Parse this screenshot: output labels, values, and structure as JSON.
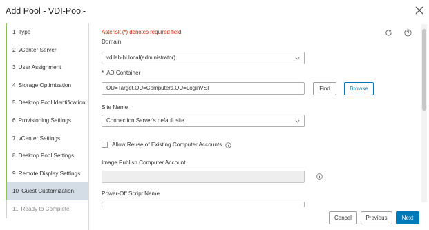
{
  "dialog": {
    "title": "Add Pool - VDI-Pool-"
  },
  "sidebar": {
    "steps": [
      {
        "num": "1",
        "label": "Type"
      },
      {
        "num": "2",
        "label": "vCenter Server"
      },
      {
        "num": "3",
        "label": "User Assignment"
      },
      {
        "num": "4",
        "label": "Storage Optimization"
      },
      {
        "num": "5",
        "label": "Desktop Pool Identification"
      },
      {
        "num": "6",
        "label": "Provisioning Settings"
      },
      {
        "num": "7",
        "label": "vCenter Settings"
      },
      {
        "num": "8",
        "label": "Desktop Pool Settings"
      },
      {
        "num": "9",
        "label": "Remote Display Settings"
      },
      {
        "num": "10",
        "label": "Guest Customization"
      },
      {
        "num": "11",
        "label": "Ready to Complete"
      }
    ],
    "active_step": "10"
  },
  "form": {
    "required_note": "Asterisk (*) denotes required field",
    "domain": {
      "label": "Domain",
      "value": "vdilab-hi.local(administrator)"
    },
    "ad_container": {
      "star": "*",
      "label": "AD Container",
      "value": "OU=Target,OU=Computers,OU=LoginVSI",
      "find_label": "Find",
      "browse_label": "Browse"
    },
    "site_name": {
      "label": "Site Name",
      "value": "Connection Server's default site"
    },
    "allow_reuse": {
      "label": "Allow Reuse of Existing Computer Accounts",
      "checked": false
    },
    "image_publish": {
      "label": "Image Publish Computer Account",
      "value": ""
    },
    "power_off_script": {
      "label": "Power-Off Script Name",
      "value": ""
    }
  },
  "footer": {
    "cancel_label": "Cancel",
    "previous_label": "Previous",
    "next_label": "Next"
  },
  "colors": {
    "accent": "#0079b8",
    "required": "#c92100",
    "step_done": "#8bc34a",
    "active_step_bg": "#d4dde6"
  },
  "icons": {
    "close": "close-icon",
    "refresh": "refresh-icon",
    "help": "help-icon",
    "info": "info-icon",
    "chevron": "chevron-down-icon"
  }
}
